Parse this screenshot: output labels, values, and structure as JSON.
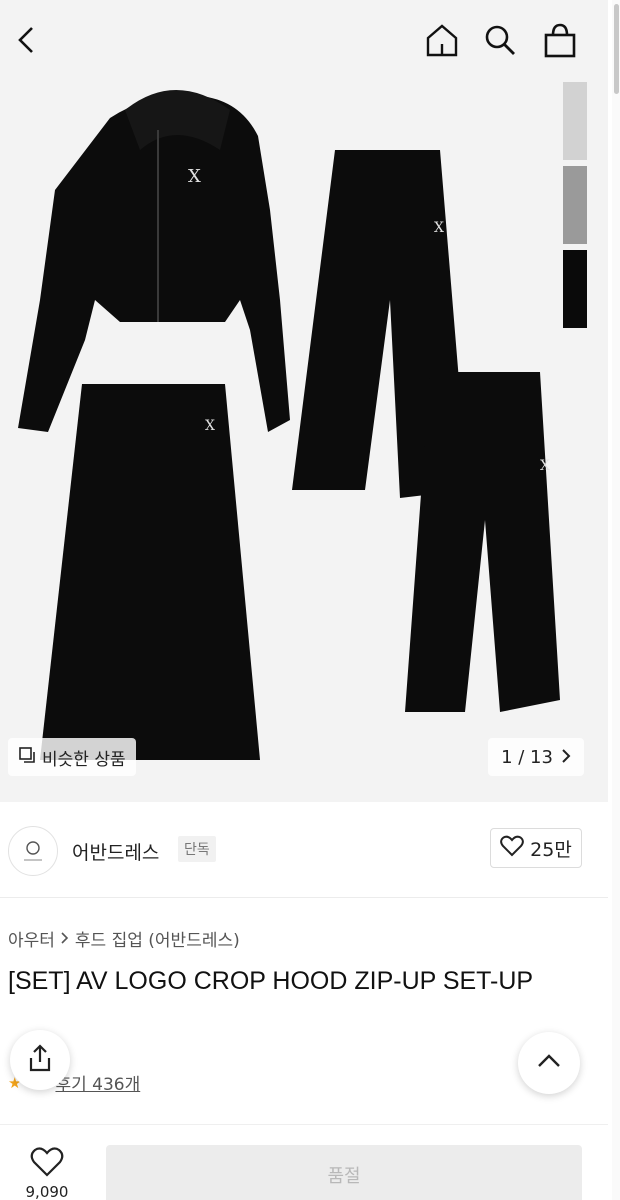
{
  "gallery": {
    "similar_label": "비슷한 상품",
    "page_indicator": "1 / 13",
    "swatch_colors": [
      "#d2d2d2",
      "#9a9a9a",
      "#0a0a0a"
    ]
  },
  "brand": {
    "name": "어반드레스",
    "badge": "단독",
    "like_count": "25만"
  },
  "breadcrumb": {
    "items": [
      "아우터",
      "후드 집업 (어반드레스)"
    ]
  },
  "product": {
    "title": "[SET] AV LOGO CROP HOOD ZIP-UP SET-UP"
  },
  "review": {
    "link": "후기 436개"
  },
  "bottom": {
    "wish_count": "9,090",
    "soldout_label": "품절"
  },
  "icons": {
    "back": "chevron-left-icon",
    "home": "home-icon",
    "search": "search-icon",
    "cart": "shopping-bag-icon",
    "share": "share-icon",
    "scroll_top": "chevron-up-icon",
    "heart": "heart-icon"
  }
}
